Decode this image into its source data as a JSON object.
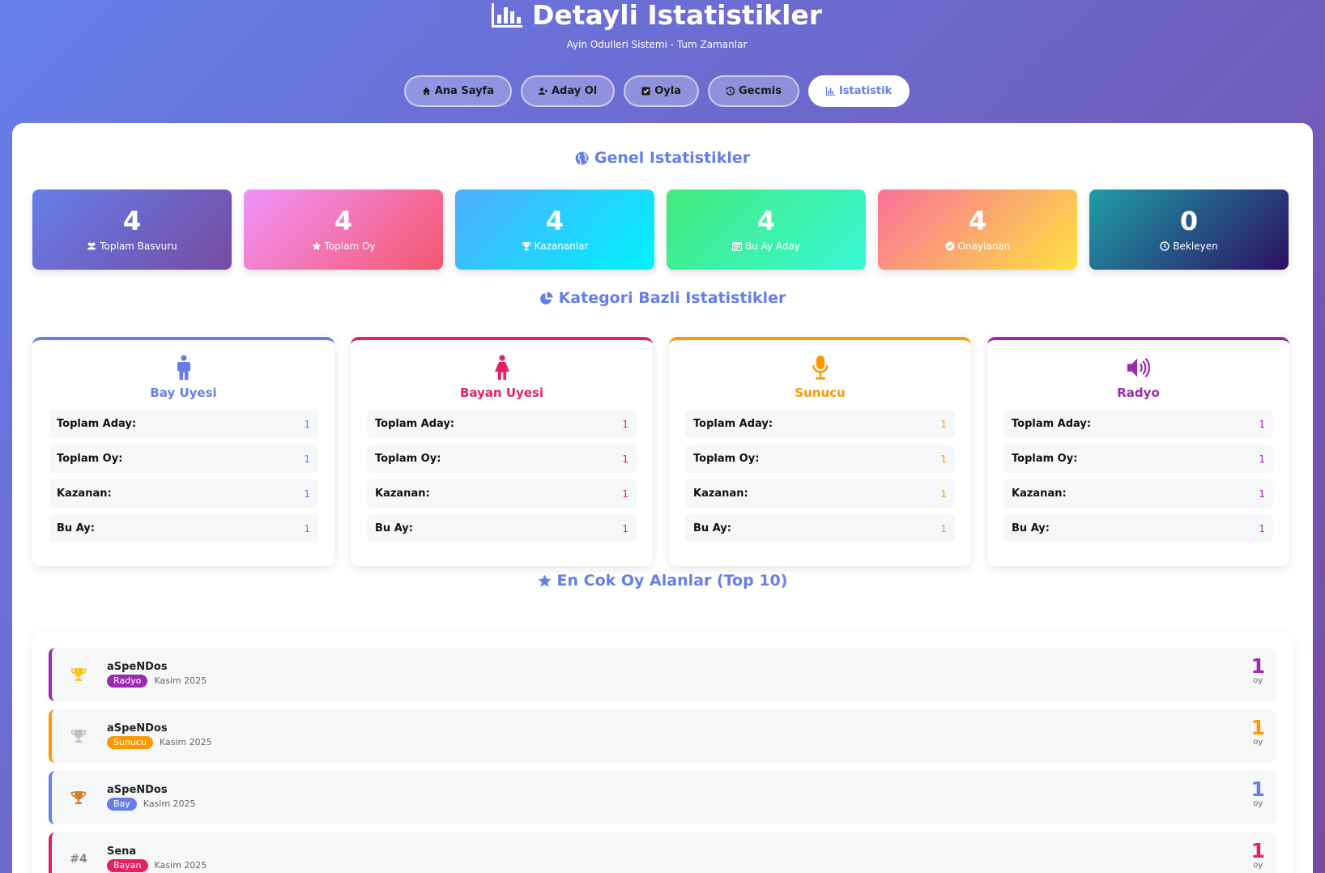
{
  "header": {
    "title": "Detayli Istatistikler",
    "subtitle": "Ayin Odulleri Sistemi - Tum Zamanlar"
  },
  "nav": [
    {
      "label": "Ana Sayfa",
      "icon": "home-icon"
    },
    {
      "label": "Aday Ol",
      "icon": "user-plus-icon"
    },
    {
      "label": "Oyla",
      "icon": "check-square-icon"
    },
    {
      "label": "Gecmis",
      "icon": "history-icon"
    },
    {
      "label": "Istatistik",
      "icon": "bar-chart-icon",
      "active": true
    }
  ],
  "general": {
    "title": "Genel Istatistikler",
    "cards": [
      {
        "value": "4",
        "label": "Toplam Basvuru",
        "icon": "users-icon",
        "gradient": [
          "#667eea",
          "#764ba2"
        ]
      },
      {
        "value": "4",
        "label": "Toplam Oy",
        "icon": "star-icon",
        "gradient": [
          "#f093fb",
          "#f5576c"
        ]
      },
      {
        "value": "4",
        "label": "Kazananlar",
        "icon": "trophy-icon",
        "gradient": [
          "#4facfe",
          "#00f2fe"
        ]
      },
      {
        "value": "4",
        "label": "Bu Ay Aday",
        "icon": "calendar-icon",
        "gradient": [
          "#43e97b",
          "#38f9d7"
        ]
      },
      {
        "value": "4",
        "label": "Onaylanan",
        "icon": "check-circle-icon",
        "gradient": [
          "#fa709a",
          "#fee140"
        ]
      },
      {
        "value": "0",
        "label": "Bekleyen",
        "icon": "clock-icon",
        "gradient": [
          "#1e9ea8",
          "#2d0f63"
        ]
      }
    ]
  },
  "categories": {
    "title": "Kategori Bazli Istatistikler",
    "row_labels": {
      "total_candidates": "Toplam Aday:",
      "total_votes": "Toplam Oy:",
      "winner": "Kazanan:",
      "this_month": "Bu Ay:"
    },
    "items": [
      {
        "name": "Bay Uyesi",
        "icon": "male-icon",
        "color": "#667eea",
        "total_candidates": "1",
        "total_votes": "1",
        "winner": "1",
        "this_month": "1"
      },
      {
        "name": "Bayan Uyesi",
        "icon": "female-icon",
        "color": "#e91e63",
        "total_candidates": "1",
        "total_votes": "1",
        "winner": "1",
        "this_month": "1"
      },
      {
        "name": "Sunucu",
        "icon": "microphone-icon",
        "color": "#ff9800",
        "total_candidates": "1",
        "total_votes": "1",
        "winner": "1",
        "this_month": "1"
      },
      {
        "name": "Radyo",
        "icon": "volume-icon",
        "color": "#9c27b0",
        "total_candidates": "1",
        "total_votes": "1",
        "winner": "1",
        "this_month": "1"
      }
    ]
  },
  "top": {
    "title": "En Cok Oy Alanlar (Top 10)",
    "vote_unit": "oy",
    "items": [
      {
        "rank": "",
        "rank_icon": "trophy-gold-icon",
        "name": "aSpeNDos",
        "category": "Radyo",
        "date": "Kasim 2025",
        "votes": "1",
        "color": "#9c27b0"
      },
      {
        "rank": "",
        "rank_icon": "trophy-silver-icon",
        "name": "aSpeNDos",
        "category": "Sunucu",
        "date": "Kasim 2025",
        "votes": "1",
        "color": "#ff9800"
      },
      {
        "rank": "",
        "rank_icon": "trophy-bronze-icon",
        "name": "aSpeNDos",
        "category": "Bay",
        "date": "Kasim 2025",
        "votes": "1",
        "color": "#667eea"
      },
      {
        "rank": "#4",
        "rank_icon": "",
        "name": "Sena",
        "category": "Bayan",
        "date": "Kasim 2025",
        "votes": "1",
        "color": "#e91e63"
      }
    ]
  }
}
